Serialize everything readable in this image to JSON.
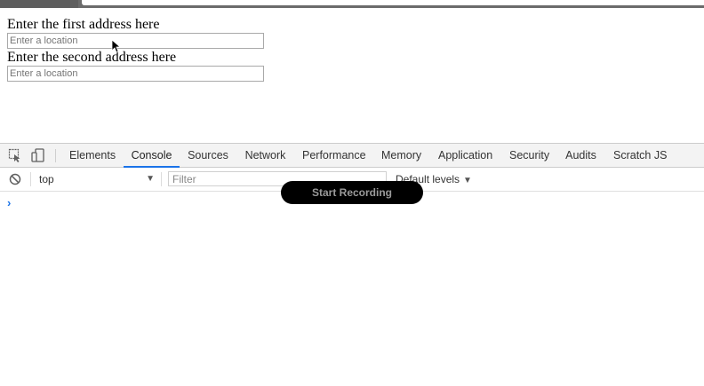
{
  "page": {
    "first_label": "Enter the first address here",
    "first_placeholder": "Enter a location",
    "second_label": "Enter the second address here",
    "second_placeholder": "Enter a location"
  },
  "devtools": {
    "tabs": [
      {
        "label": "Elements"
      },
      {
        "label": "Console"
      },
      {
        "label": "Sources"
      },
      {
        "label": "Network"
      },
      {
        "label": "Performance"
      },
      {
        "label": "Memory"
      },
      {
        "label": "Application"
      },
      {
        "label": "Security"
      },
      {
        "label": "Audits"
      },
      {
        "label": "Scratch JS"
      }
    ],
    "active_tab": "Console",
    "toolbar": {
      "context": "top",
      "filter_placeholder": "Filter",
      "levels": "Default levels"
    },
    "prompt_symbol": "›"
  },
  "recorder": {
    "label": "Start Recording"
  },
  "colors": {
    "accent": "#1a73e8",
    "chrome": "#6b6b6b"
  }
}
